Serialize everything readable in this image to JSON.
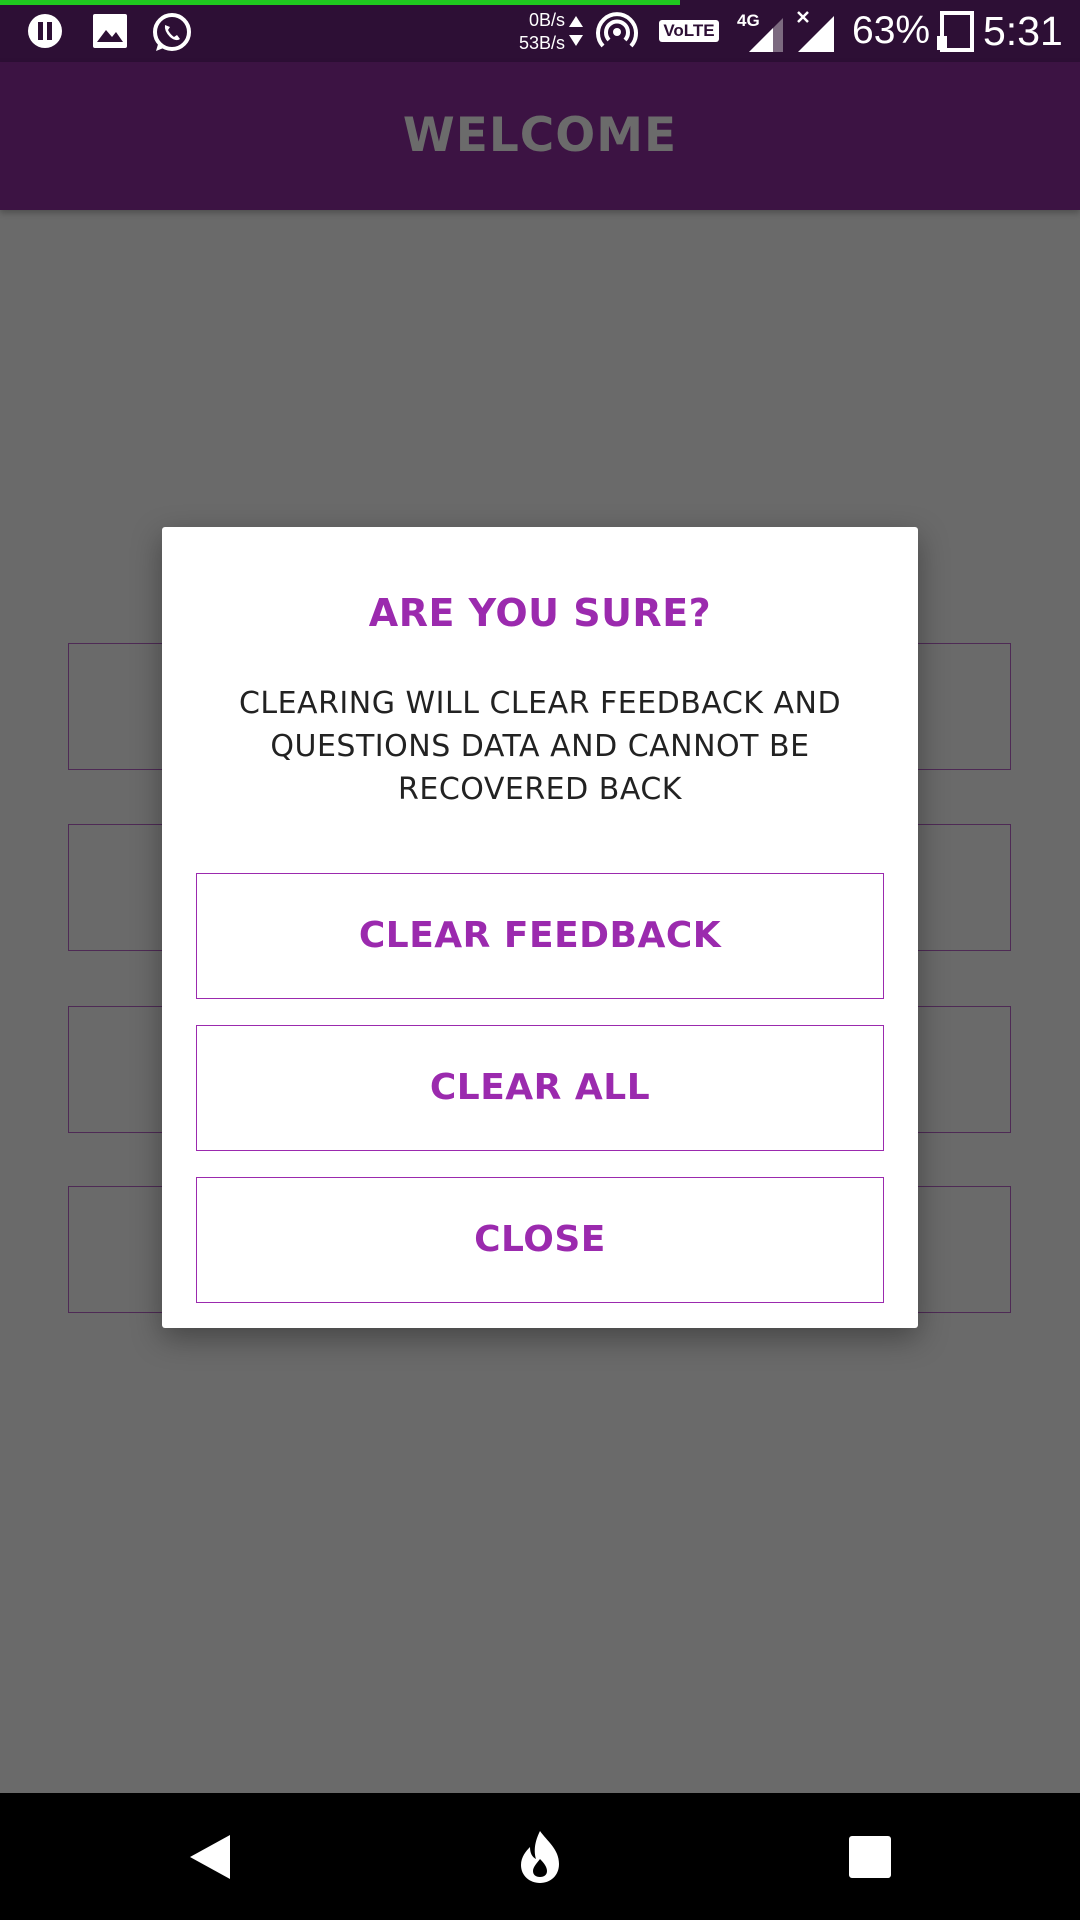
{
  "status_bar": {
    "net_up": "0B/s",
    "net_down": "53B/s",
    "volte": "VoLTE",
    "network_type": "4G",
    "battery_percent": "63%",
    "time": "5:31",
    "icons": [
      "pause-icon",
      "gallery-icon",
      "whatsapp-icon",
      "hotspot-icon",
      "signal-icon",
      "battery-icon"
    ],
    "accent_color": "#1fc81f",
    "progress": 0.63
  },
  "app_bar": {
    "title": "WELCOME",
    "color": "#3c1343"
  },
  "dialog": {
    "title": "ARE YOU SURE?",
    "message": "CLEARING WILL CLEAR FEEDBACK AND QUESTIONS DATA AND CANNOT BE RECOVERED BACK",
    "buttons": {
      "clear_feedback": "CLEAR FEEDBACK",
      "clear_all": "CLEAR ALL",
      "close": "CLOSE"
    },
    "accent_color": "#9b2aae"
  },
  "nav_bar": {
    "icons": [
      "back-icon",
      "home-icon",
      "recents-icon"
    ]
  }
}
